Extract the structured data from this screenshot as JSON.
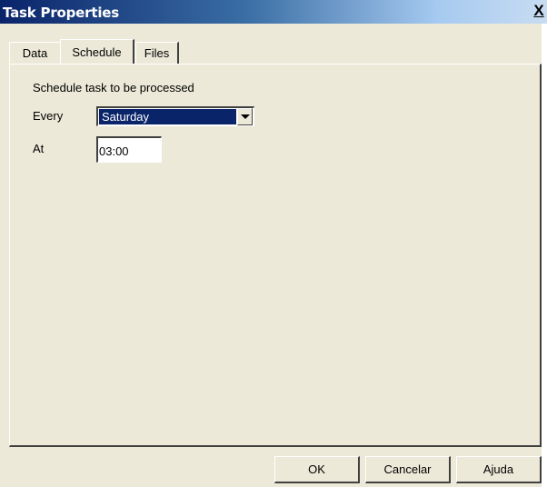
{
  "window": {
    "title": "Task Properties",
    "close_label": "X"
  },
  "tabs": [
    {
      "label": "Data",
      "active": false
    },
    {
      "label": "Schedule",
      "active": true
    },
    {
      "label": "Files",
      "active": false
    }
  ],
  "schedule": {
    "heading": "Schedule task to be processed",
    "every_label": "Every",
    "every_value": "Saturday",
    "at_label": "At",
    "at_value": "03:00"
  },
  "buttons": {
    "ok": "OK",
    "cancel": "Cancelar",
    "help": "Ajuda"
  },
  "colors": {
    "titlebar_start": "#0a246a",
    "selection": "#0a246a",
    "dialog_bg": "#ece9d8"
  }
}
